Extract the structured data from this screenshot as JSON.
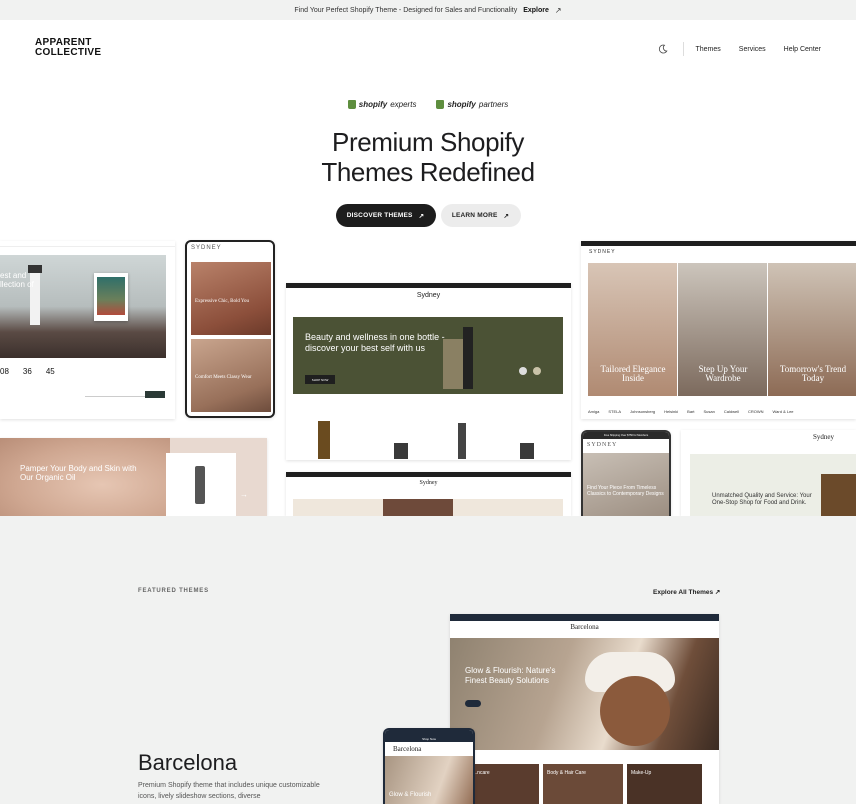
{
  "banner": {
    "text": "Find Your Perfect Shopify Theme - Designed for Sales and Functionality",
    "link": "Explore",
    "arrow": "↗"
  },
  "brand": {
    "line1": "APPARENT",
    "line2": "COLLECTIVE"
  },
  "nav": {
    "items": [
      "Themes",
      "Services",
      "Help Center"
    ],
    "icon": "moon-icon"
  },
  "partners": [
    {
      "brand": "shopify",
      "suffix": "experts"
    },
    {
      "brand": "shopify",
      "suffix": "partners"
    }
  ],
  "hero": {
    "title_line1": "Premium Shopify",
    "title_line2": "Themes Redefined"
  },
  "buttons": {
    "discover": "DISCOVER THEMES",
    "learn": "LEARN MORE",
    "arrow": "↗"
  },
  "collage": {
    "left_stats": [
      {
        "num": "08"
      },
      {
        "num": "36"
      },
      {
        "num": "45"
      }
    ],
    "left_text": "est and\nllection of",
    "left_bottom": "Pamper Your Body and Skin with Our Organic Oil",
    "sydney_mobile_logo": "SYDNEY",
    "sydney_card1": "Expressive Chic, Bold You",
    "sydney_card2": "Comfort Meets Classy Wear",
    "center_logo": "Sydney",
    "center_headline": "Beauty and wellness in one bottle - discover your best self with us",
    "center_btn": "SHOP NOW",
    "center2_logo": "Sydney",
    "right_logo": "SYDNEY",
    "right_panels": [
      "Tailored Elegance Inside",
      "Step Up Your Wardrobe",
      "Tomorrow's Trend Today"
    ],
    "right_brands": [
      "Amiga",
      "STELA",
      "Johnsonsberg",
      "Helsinki",
      "Bart",
      "Susan",
      "Caldwell",
      "CROWN",
      "Ward & Lee"
    ],
    "right_mobile_banner": "Free Shipping Over $750 for Members",
    "right_mobile_logo": "SYDNEY",
    "right_mobile_text": "Find Your Piece From Timeless Classics to Contemporary Designs",
    "right_bottom_logo": "Sydney",
    "right_bottom_text": "Unmatched Quality and Service: Your One-Stop Shop for Food and Drink."
  },
  "featured": {
    "label": "FEATURED THEMES",
    "explore": "Explore All Themes",
    "arrow": "↗",
    "theme_name": "Barcelona",
    "theme_desc": "Premium Shopify theme that includes unique customizable icons, lively slideshow sections, diverse",
    "preview": {
      "logo": "Barcelona",
      "headline": "Glow & Flourish: Nature's Finest Beauty Solutions",
      "cards": [
        "...ncare",
        "Body & Hair Care",
        "Make-Up"
      ],
      "mobile_logo": "Barcelona",
      "mobile_shop": "Shop Now",
      "mobile_text": "Glow & Flourish"
    }
  },
  "colors": {
    "accent": "#1d1d1d",
    "grey_bg": "#f1f2f1",
    "olive": "#4b5235",
    "shopify_green": "#5e8e3e"
  }
}
